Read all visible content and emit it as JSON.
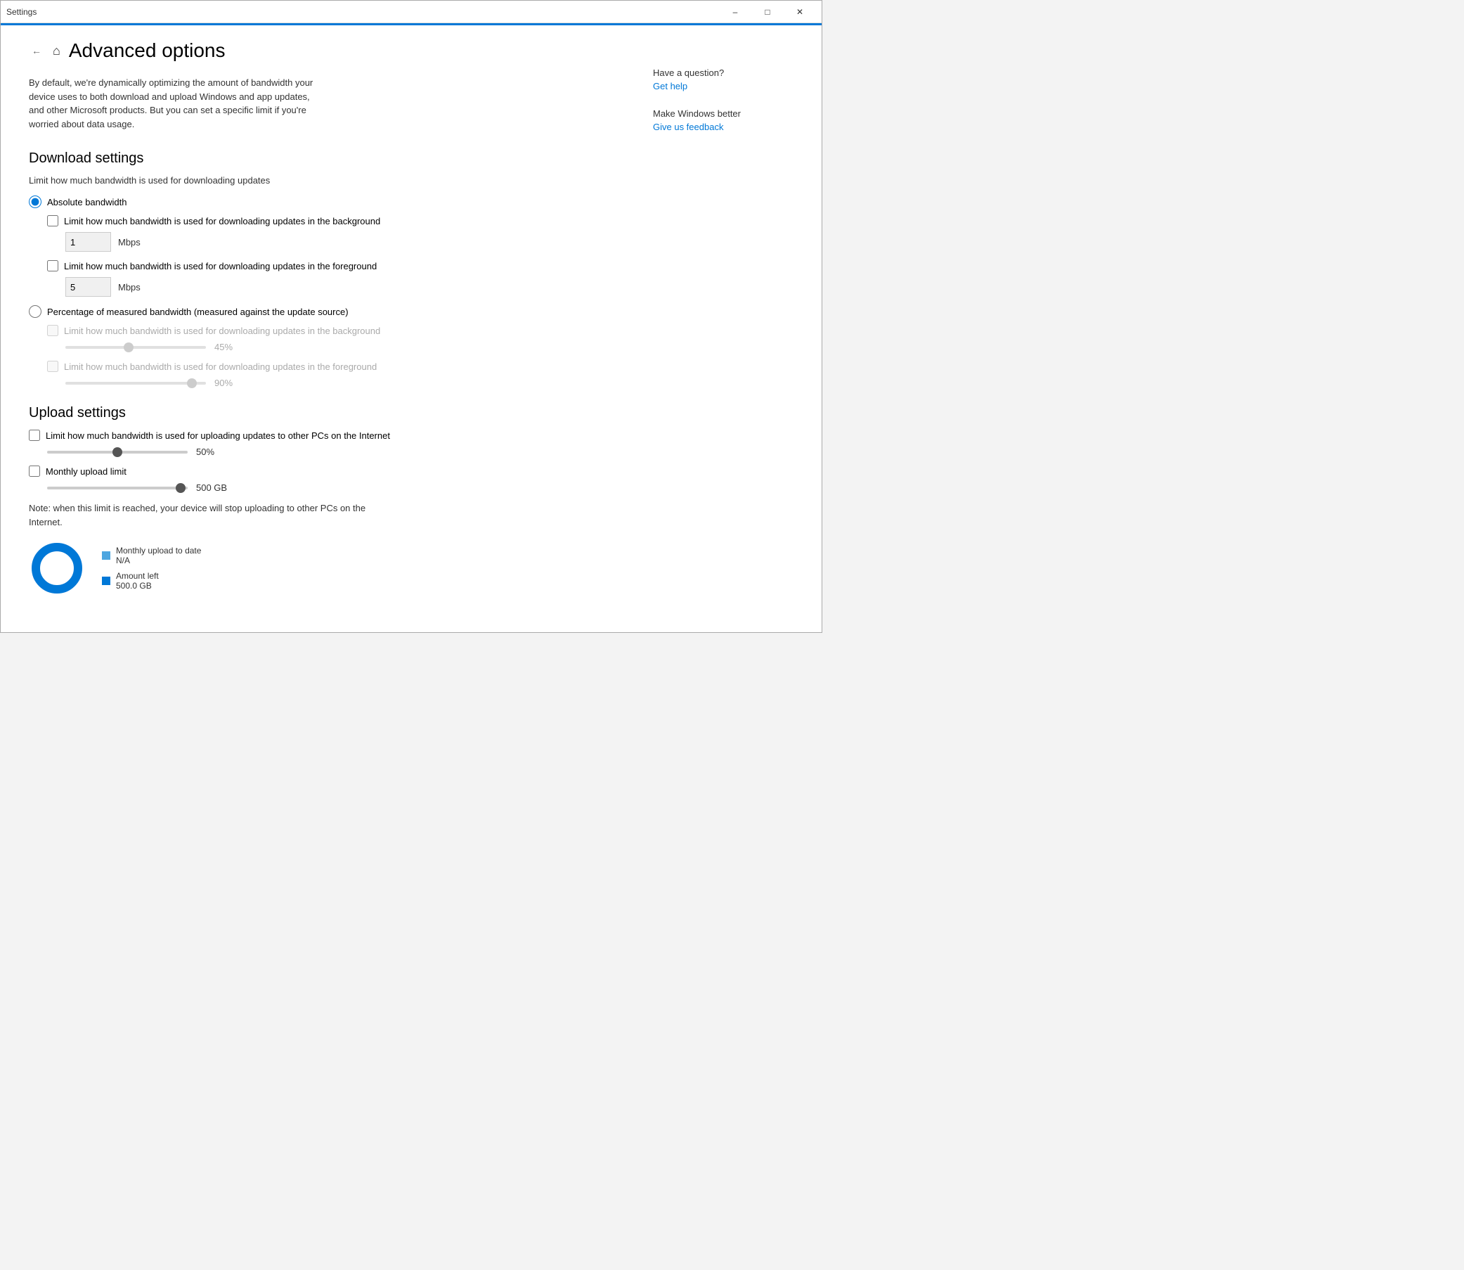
{
  "titlebar": {
    "title": "Settings",
    "minimize_label": "–",
    "restore_label": "□",
    "close_label": "✕"
  },
  "page": {
    "title": "Advanced options",
    "description": "By default, we're dynamically optimizing the amount of bandwidth your device uses to both download and upload Windows and app updates, and other Microsoft products. But you can set a specific limit if you're worried about data usage."
  },
  "download_settings": {
    "section_title": "Download settings",
    "subtitle": "Limit how much bandwidth is used for downloading updates",
    "radio_options": [
      {
        "id": "absolute",
        "label": "Absolute bandwidth",
        "checked": true
      },
      {
        "id": "percentage",
        "label": "Percentage of measured bandwidth (measured against the update source)",
        "checked": false
      }
    ],
    "background_checkbox_absolute": {
      "label": "Limit how much bandwidth is used for downloading updates in the background",
      "checked": false,
      "disabled": false
    },
    "background_input": {
      "value": "1",
      "unit": "Mbps"
    },
    "foreground_checkbox_absolute": {
      "label": "Limit how much bandwidth is used for downloading updates in the foreground",
      "checked": false,
      "disabled": false
    },
    "foreground_input": {
      "value": "5",
      "unit": "Mbps"
    },
    "background_checkbox_pct": {
      "label": "Limit how much bandwidth is used for downloading updates in the background",
      "checked": false,
      "disabled": true
    },
    "background_slider": {
      "value": 45,
      "display": "45%",
      "disabled": true,
      "position_pct": 45
    },
    "foreground_checkbox_pct": {
      "label": "Limit how much bandwidth is used for downloading updates in the foreground",
      "checked": false,
      "disabled": true
    },
    "foreground_slider": {
      "value": 90,
      "display": "90%",
      "disabled": true,
      "position_pct": 90
    }
  },
  "upload_settings": {
    "section_title": "Upload settings",
    "upload_checkbox": {
      "label": "Limit how much bandwidth is used for uploading updates to other PCs on the Internet",
      "checked": false
    },
    "upload_slider": {
      "value": 50,
      "display": "50%",
      "position_pct": 50
    },
    "monthly_checkbox": {
      "label": "Monthly upload limit",
      "checked": false
    },
    "monthly_slider": {
      "value": 500,
      "display": "500 GB",
      "position_pct": 95
    },
    "note": "Note: when this limit is reached, your device will stop uploading to other PCs on the Internet.",
    "chart": {
      "monthly_upload_label": "Monthly upload to date",
      "monthly_upload_value": "N/A",
      "amount_left_label": "Amount left",
      "amount_left_value": "500.0 GB"
    }
  },
  "help_panel": {
    "question": "Have a question?",
    "get_help": "Get help",
    "make_better": "Make Windows better",
    "feedback": "Give us feedback"
  }
}
